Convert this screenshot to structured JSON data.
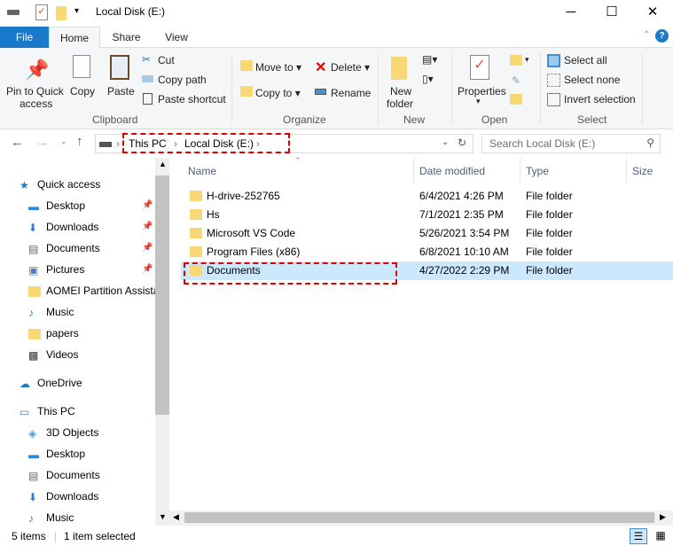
{
  "window": {
    "title": "Local Disk (E:)",
    "minimize": "─",
    "maximize": "☐",
    "close": "✕"
  },
  "tabs": [
    {
      "label": "File"
    },
    {
      "label": "Home"
    },
    {
      "label": "Share"
    },
    {
      "label": "View"
    }
  ],
  "ribbon": {
    "clipboard": {
      "pin": "Pin to Quick",
      "pin2": "access",
      "copy": "Copy",
      "paste": "Paste",
      "cut": "Cut",
      "copy_path": "Copy path",
      "paste_shortcut": "Paste shortcut",
      "label": "Clipboard"
    },
    "organize": {
      "move_to": "Move to",
      "copy_to": "Copy to",
      "delete": "Delete",
      "rename": "Rename",
      "label": "Organize"
    },
    "new": {
      "new_folder": "New",
      "new_folder2": "folder",
      "label": "New"
    },
    "open": {
      "properties": "Properties",
      "label": "Open"
    },
    "select": {
      "select_all": "Select all",
      "select_none": "Select none",
      "invert": "Invert selection",
      "label": "Select"
    }
  },
  "address": {
    "crumbs": [
      "This PC",
      "Local Disk (E:)"
    ],
    "search_placeholder": "Search Local Disk (E:)"
  },
  "nav": {
    "items": [
      {
        "label": "Quick access",
        "icon": "star-icon",
        "pinned": false
      },
      {
        "label": "Desktop",
        "icon": "desktop-icon",
        "pinned": true
      },
      {
        "label": "Downloads",
        "icon": "download-icon",
        "pinned": true
      },
      {
        "label": "Documents",
        "icon": "documents-icon",
        "pinned": true
      },
      {
        "label": "Pictures",
        "icon": "pictures-icon",
        "pinned": true
      },
      {
        "label": "AOMEI Partition Assista",
        "icon": "folder-icon",
        "pinned": false
      },
      {
        "label": "Music",
        "icon": "music-icon",
        "pinned": false
      },
      {
        "label": "papers",
        "icon": "folder-icon",
        "pinned": false
      },
      {
        "label": "Videos",
        "icon": "videos-icon",
        "pinned": false
      },
      {
        "label": "OneDrive",
        "icon": "cloud-icon",
        "pinned": false
      },
      {
        "label": "This PC",
        "icon": "pc-icon",
        "pinned": false
      },
      {
        "label": "3D Objects",
        "icon": "cube-icon",
        "pinned": false
      },
      {
        "label": "Desktop",
        "icon": "desktop-icon",
        "pinned": false
      },
      {
        "label": "Documents",
        "icon": "documents-icon",
        "pinned": false
      },
      {
        "label": "Downloads",
        "icon": "download-icon",
        "pinned": false
      },
      {
        "label": "Music",
        "icon": "music-icon",
        "pinned": false
      }
    ]
  },
  "columns": {
    "name": "Name",
    "date": "Date modified",
    "type": "Type",
    "size": "Size"
  },
  "files": [
    {
      "name": "H-drive-252765",
      "date": "6/4/2021 4:26 PM",
      "type": "File folder"
    },
    {
      "name": "Hs",
      "date": "7/1/2021 2:35 PM",
      "type": "File folder"
    },
    {
      "name": "Microsoft VS Code",
      "date": "5/26/2021 3:54 PM",
      "type": "File folder"
    },
    {
      "name": "Program Files (x86)",
      "date": "6/8/2021 10:10 AM",
      "type": "File folder"
    },
    {
      "name": "Documents",
      "date": "4/27/2022 2:29 PM",
      "type": "File folder",
      "selected": true
    }
  ],
  "status": {
    "count": "5 items",
    "selected": "1 item selected"
  },
  "colors": {
    "accent": "#1979ca",
    "selection": "#cce8ff",
    "highlight": "#e00000"
  }
}
